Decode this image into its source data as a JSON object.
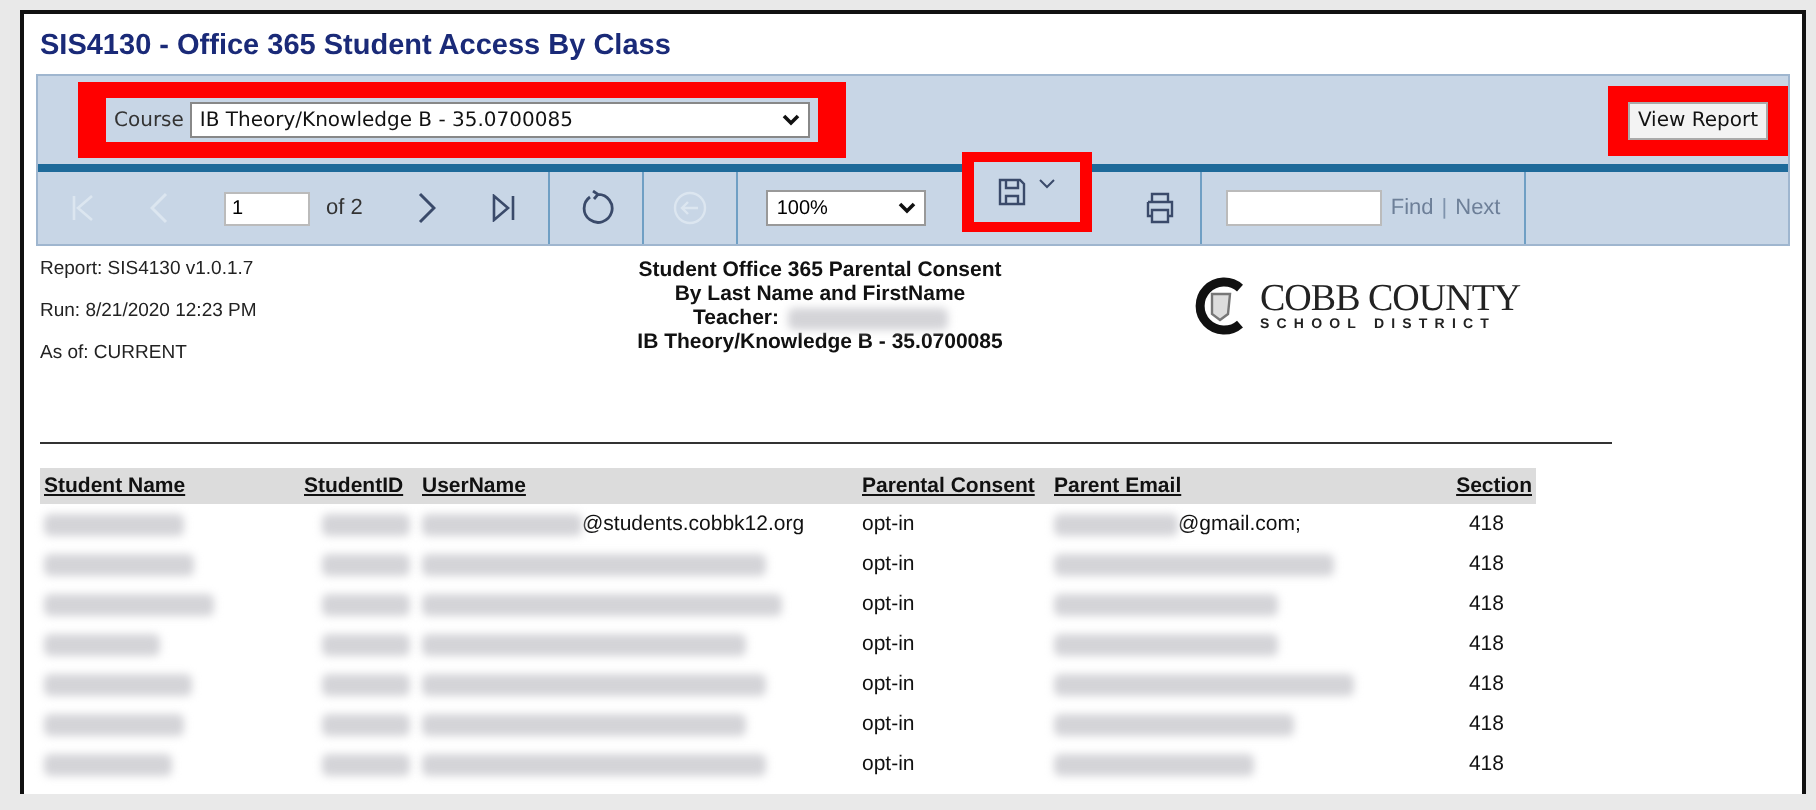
{
  "window": {
    "title": "SIS4130 - Office 365 Student Access By Class"
  },
  "parameters": {
    "course_label": "Course",
    "course_value": "IB Theory/Knowledge B - 35.0700085",
    "highlighted": true,
    "view_report": {
      "label": "View Report",
      "highlighted": true
    }
  },
  "toolbar": {
    "page": "1",
    "page_count": "of 2",
    "zoom": "100%",
    "save_highlighted": true,
    "find_label": "Find",
    "separator": "|",
    "next_label": "Next"
  },
  "report": {
    "info": [
      "Report:  SIS4130 v1.0.1.7",
      "Run:  8/21/2020 12:23 PM",
      "As of: CURRENT"
    ],
    "heading": [
      "Student Office 365 Parental Consent",
      "By Last Name and FirstName",
      "Teacher:",
      "IB Theory/Knowledge B - 35.0700085"
    ],
    "logo": {
      "name": "COBB COUNTY",
      "subtitle": "SCHOOL DISTRICT"
    }
  },
  "table": {
    "columns": [
      "Student Name",
      "StudentID",
      "UserName",
      "Parental Consent",
      "Parent Email",
      "Section"
    ],
    "rows": [
      {
        "username_suffix": "@students.cobbk12.org",
        "consent": "opt-in",
        "email_suffix": "@gmail.com;",
        "section": "418"
      },
      {
        "consent": "opt-in",
        "section": "418"
      },
      {
        "consent": "opt-in",
        "section": "418"
      },
      {
        "consent": "opt-in",
        "section": "418"
      },
      {
        "consent": "opt-in",
        "section": "418"
      },
      {
        "consent": "opt-in",
        "section": "418"
      },
      {
        "consent": "opt-in",
        "section": "418"
      }
    ]
  }
}
